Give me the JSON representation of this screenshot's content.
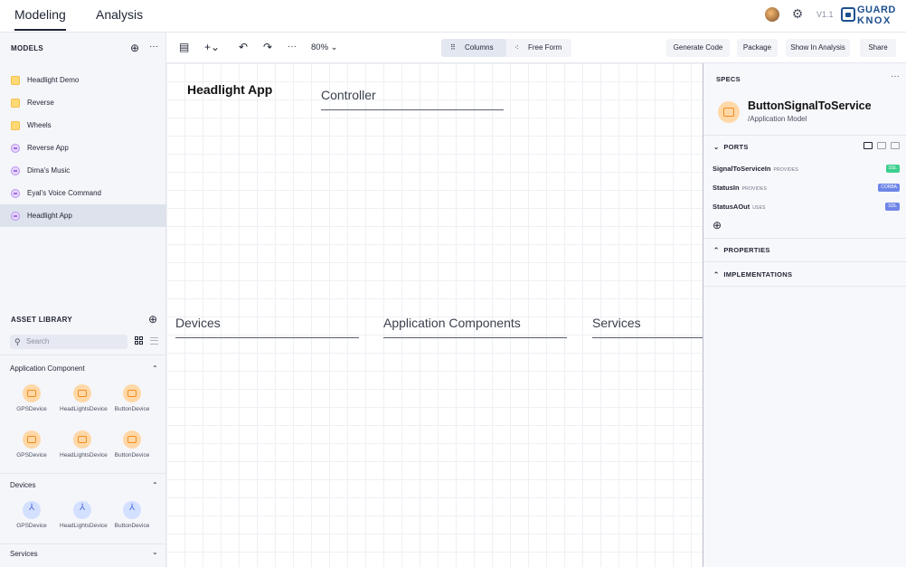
{
  "topbar": {
    "tabs": [
      {
        "label": "Modeling",
        "active": true
      },
      {
        "label": "Analysis",
        "active": false
      }
    ],
    "version": "V1.1",
    "logo_line1": "GUARD",
    "logo_line2": "KNOX"
  },
  "sidebar": {
    "models_header": "MODELS",
    "models": [
      {
        "label": "Headlight Demo",
        "icon": "folder-icon",
        "color": "yellow"
      },
      {
        "label": "Reverse",
        "icon": "folder-icon",
        "color": "yellow"
      },
      {
        "label": "Wheels",
        "icon": "folder-icon",
        "color": "yellow"
      },
      {
        "label": "Reverse App",
        "icon": "app-icon",
        "color": "purple"
      },
      {
        "label": "Dima's Music",
        "icon": "app-icon",
        "color": "purple"
      },
      {
        "label": "Eyal's Voice Command",
        "icon": "app-icon",
        "color": "purple"
      },
      {
        "label": "Headlight App",
        "icon": "app-icon",
        "color": "purple",
        "selected": true
      }
    ],
    "asset_header": "ASSET LIBRARY",
    "search_placeholder": "Search",
    "categories": {
      "app_components": {
        "label": "Application Component",
        "items": [
          "GPSDevice",
          "HeadLightsDevice",
          "ButtonDevice",
          "GPSDevice",
          "HeadLightsDevice",
          "ButtonDevice"
        ]
      },
      "devices": {
        "label": "Devices",
        "items": [
          "GPSDevice",
          "HeadLightsDevice",
          "ButtonDevice"
        ]
      },
      "services": {
        "label": "Services"
      }
    }
  },
  "toolbar": {
    "zoom": "80%",
    "view_columns": "Columns",
    "view_free": "Free Form",
    "actions": [
      "Generate Code",
      "Package",
      "Show In Analysis",
      "Share"
    ]
  },
  "canvas": {
    "app_title": "Headlight App",
    "columns": [
      "Controller",
      "Devices",
      "Application Components",
      "Services"
    ]
  },
  "specs": {
    "header": "SPECS",
    "component_name": "ButtonSignalToService",
    "component_path": "/Application Model",
    "ports_header": "PORTS",
    "ports": [
      {
        "name": "SignalToServiceIn",
        "kind": "PROVIDES",
        "badge": "SSL",
        "badge_color": "#3ccf8e"
      },
      {
        "name": "StatusIn",
        "kind": "PROVIDES",
        "badge": "CORBA",
        "badge_color": "#6f86e8"
      },
      {
        "name": "StatusAOut",
        "kind": "USES",
        "badge": "SDL",
        "badge_color": "#6f86e8"
      }
    ],
    "properties_header": "PROPERTIES",
    "implementations_header": "IMPLEMENTATIONS"
  }
}
